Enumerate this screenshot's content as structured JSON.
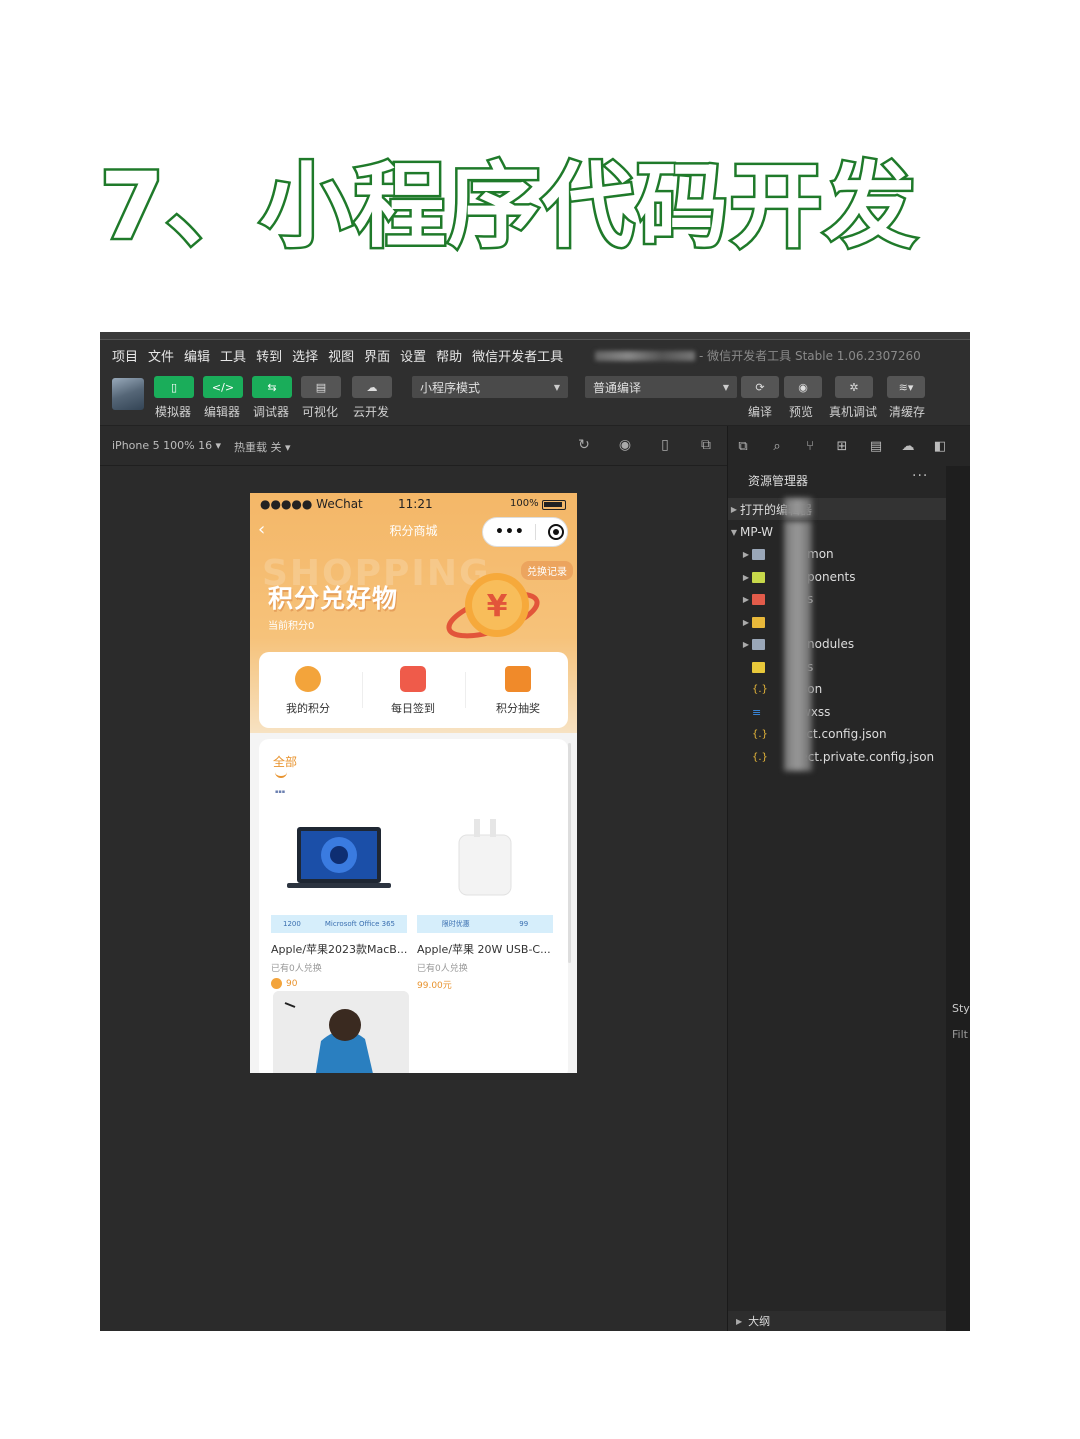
{
  "page_title": "7、小程序代码开发",
  "menu": {
    "items": [
      "项目",
      "文件",
      "编辑",
      "工具",
      "转到",
      "选择",
      "视图",
      "界面",
      "设置",
      "帮助",
      "微信开发者工具"
    ],
    "window_title": "- 微信开发者工具 Stable 1.06.2307260"
  },
  "toolbar": {
    "simulator": "模拟器",
    "editor": "编辑器",
    "debugger": "调试器",
    "visual": "可视化",
    "cloud": "云开发",
    "mode_select": "小程序模式",
    "compile_select": "普通编译",
    "compile": "编译",
    "preview": "预览",
    "remote_debug": "真机调试",
    "clear_cache": "清缓存"
  },
  "subbar": {
    "device": "iPhone 5 100% 16 ▾",
    "hot_reload": "热重载 关 ▾"
  },
  "phone": {
    "status_left": "●●●●● WeChat",
    "status_time": "11:21",
    "status_battery": "100%",
    "nav_title": "积分商城",
    "capsule_dots": "•••",
    "bg_word": "SHOPPING",
    "exchange_record": "兑换记录",
    "hero_title": "积分兑好物",
    "hero_sub": "当前积分0",
    "quick": [
      {
        "label": "我的积分",
        "color": "#f3a43b"
      },
      {
        "label": "每日签到",
        "color": "#ef5b4a"
      },
      {
        "label": "积分抽奖",
        "color": "#f08a2a"
      }
    ],
    "tab_all": "全部",
    "products": [
      {
        "name": "Apple/苹果2023款MacB...",
        "sold": "已有0人兑换",
        "price": "90",
        "banner_left": "1200",
        "banner_right": "Microsoft Office 365"
      },
      {
        "name": "Apple/苹果 20W USB-C...",
        "sold": "已有0人兑换",
        "price": "99.00元",
        "banner_left": "限时优惠",
        "banner_right": "99"
      }
    ]
  },
  "explorer": {
    "header": "资源管理器",
    "more": "···",
    "opened_editors": "打开的编辑器",
    "project": "MP-W",
    "files": [
      "mon",
      "ponents",
      "s",
      "",
      "nodules",
      "s",
      "son",
      "wxss",
      "ect.config.json",
      "ject.private.config.json"
    ],
    "outline": "大纲",
    "right_tab_style": "Sty",
    "right_tab_filter": "Filt"
  }
}
